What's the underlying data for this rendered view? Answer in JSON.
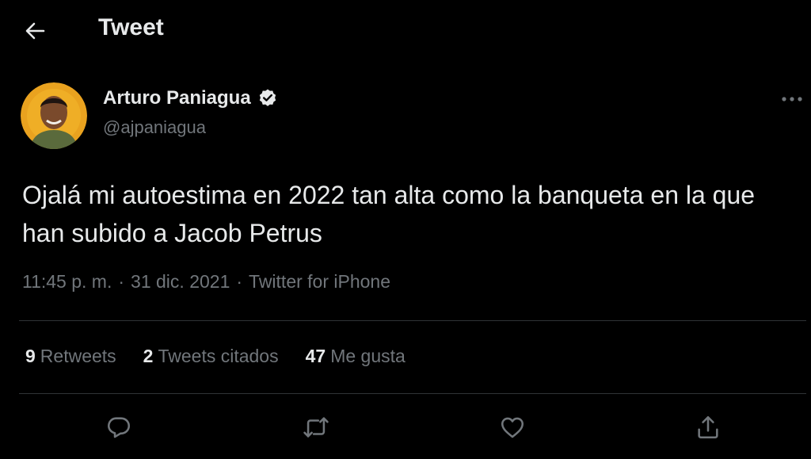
{
  "header": {
    "back_icon": "arrow-left-icon",
    "title": "Tweet"
  },
  "author": {
    "name": "Arturo Paniagua",
    "handle": "@ajpaniagua",
    "verified_icon": "verified-badge-icon"
  },
  "tweet": {
    "text": "Ojalá mi autoestima en 2022 tan alta como la banqueta en la que han subido a Jacob Petrus",
    "time": "11:45 p. m.",
    "date": "31 dic. 2021",
    "source": "Twitter for iPhone",
    "separator": "·"
  },
  "stats": [
    {
      "count": "9",
      "label": "Retweets"
    },
    {
      "count": "2",
      "label": "Tweets citados"
    },
    {
      "count": "47",
      "label": "Me gusta"
    }
  ],
  "actions": [
    {
      "name": "reply",
      "icon": "reply-icon"
    },
    {
      "name": "retweet",
      "icon": "retweet-icon"
    },
    {
      "name": "like",
      "icon": "heart-icon"
    },
    {
      "name": "share",
      "icon": "share-icon"
    }
  ],
  "colors": {
    "background": "#000000",
    "text": "#e7e9ea",
    "secondary_text": "#71767b",
    "divider": "#2f3336",
    "avatar_bg": "#f0a020"
  }
}
